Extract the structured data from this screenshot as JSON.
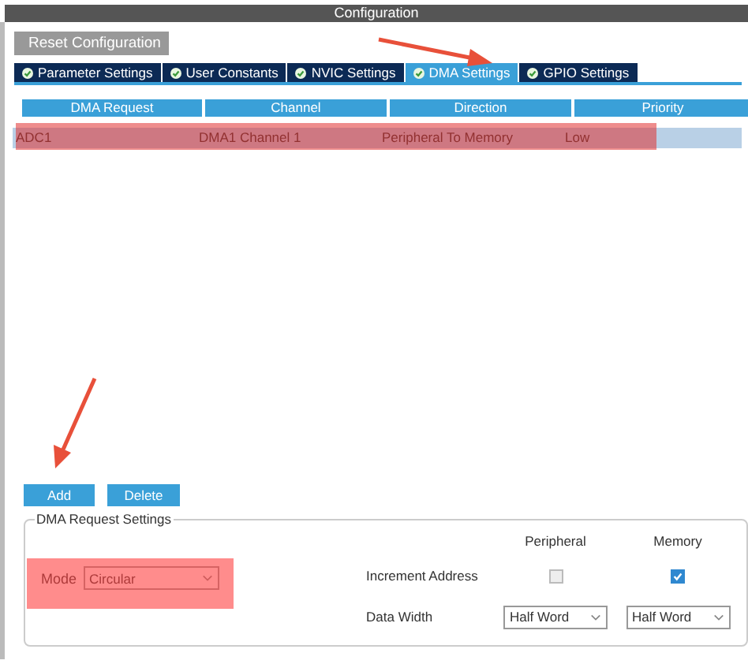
{
  "window": {
    "title": "Configuration"
  },
  "reset_button": "Reset Configuration",
  "tabs": [
    {
      "label": "Parameter Settings",
      "selected": false
    },
    {
      "label": "User Constants",
      "selected": false
    },
    {
      "label": "NVIC Settings",
      "selected": false
    },
    {
      "label": "DMA Settings",
      "selected": true
    },
    {
      "label": "GPIO Settings",
      "selected": false
    }
  ],
  "table": {
    "columns": [
      "DMA Request",
      "Channel",
      "Direction",
      "Priority"
    ],
    "rows": [
      {
        "cells": [
          "ADC1",
          "DMA1 Channel 1",
          "Peripheral To Memory",
          "Low"
        ],
        "selected": true
      }
    ]
  },
  "buttons": [
    "Add",
    "Delete"
  ],
  "request_settings": {
    "title": "DMA Request Settings",
    "mode_label": "Mode",
    "mode_value": "Circular",
    "col_headers": [
      "Peripheral",
      "Memory"
    ],
    "increment_label": "Increment Address",
    "increment": [
      {
        "checked": false
      },
      {
        "checked": true
      }
    ],
    "width_label": "Data Width",
    "widths": [
      "Half Word",
      "Half Word"
    ]
  }
}
